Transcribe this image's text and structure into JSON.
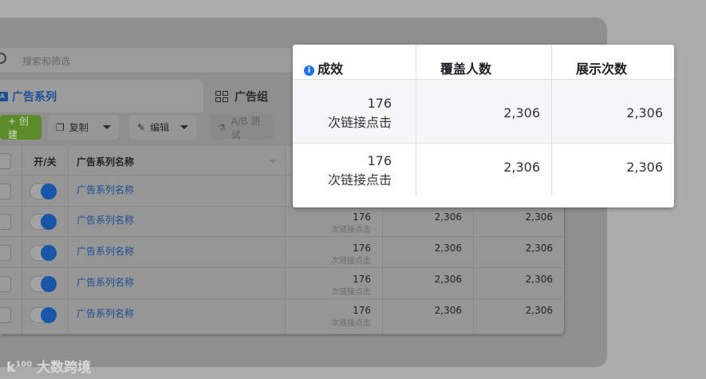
{
  "search": {
    "placeholder": "搜索和筛选"
  },
  "tabs": [
    {
      "label": "广告系列",
      "icon": "campaign-icon"
    },
    {
      "label": "广告组",
      "icon": "grid-icon"
    }
  ],
  "toolbar": {
    "create": "+ 创建",
    "copy": "复制",
    "edit": "编辑",
    "ab_test": "A/B 测试"
  },
  "table": {
    "headers": {
      "toggle": "开/关",
      "name": "广告系列名称"
    },
    "rows": [
      {
        "name": "广告系列名称",
        "result": "176",
        "result_unit": "次链接点击",
        "reach": "2,306",
        "impressions": "2,306"
      },
      {
        "name": "广告系列名称",
        "result": "176",
        "result_unit": "次链接点击",
        "reach": "2,306",
        "impressions": "2,306"
      },
      {
        "name": "广告系列名称",
        "result": "176",
        "result_unit": "次链接点击",
        "reach": "2,306",
        "impressions": "2,306"
      },
      {
        "name": "广告系列名称",
        "result": "176",
        "result_unit": "次链接点击",
        "reach": "2,306",
        "impressions": "2,306"
      },
      {
        "name": "广告系列名称",
        "result": "176",
        "result_unit": "次链接点击",
        "reach": "2,306",
        "impressions": "2,306"
      }
    ]
  },
  "popup": {
    "headers": [
      "成效",
      "覆盖人数",
      "展示次数"
    ],
    "rows": [
      {
        "result": "176",
        "result_unit": "次链接点击",
        "reach": "2,306",
        "impressions": "2,306"
      },
      {
        "result": "176",
        "result_unit": "次链接点击",
        "reach": "2,306",
        "impressions": "2,306"
      }
    ]
  },
  "watermark": "大数跨境"
}
